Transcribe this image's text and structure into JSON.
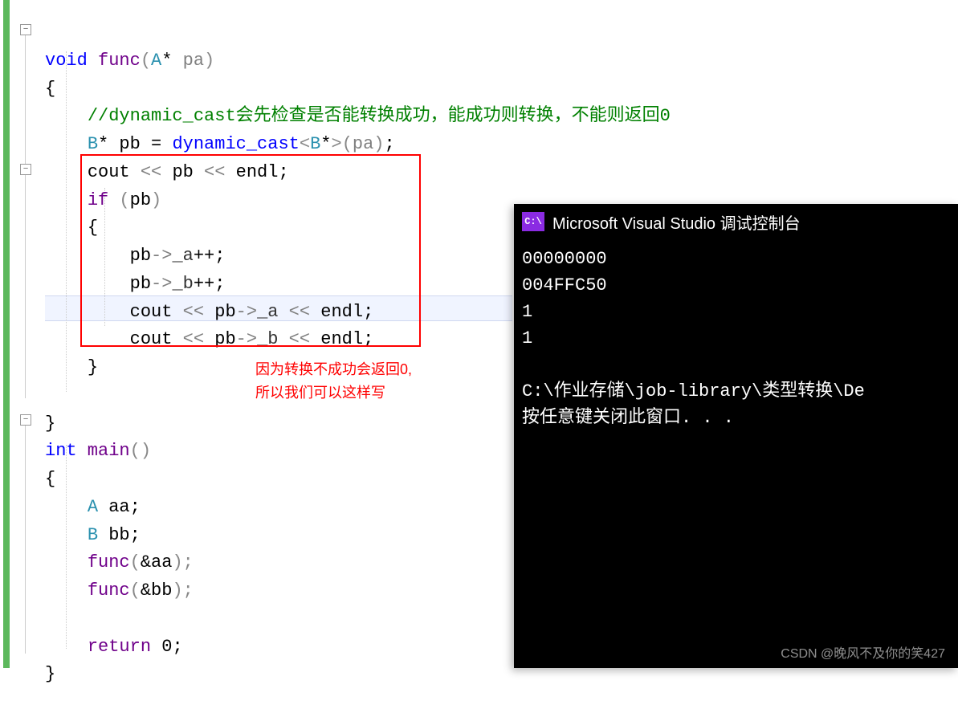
{
  "editor": {
    "fold_glyph": "−",
    "code": {
      "l1_kw_void": "void",
      "l1_func": " func",
      "l1_par_open": "(",
      "l1_type": "A",
      "l1_star": "* ",
      "l1_param": "pa",
      "l1_par_close": ")",
      "l2_brace": "{",
      "l3_comment": "//dynamic_cast会先检查是否能转换成功，能成功则转换，不能则返回0",
      "l4_type_B": "B",
      "l4_star_pb": "* pb = ",
      "l4_kw_dyn": "dynamic_cast",
      "l4_angle_open": "<",
      "l4_t": "B",
      "l4_star2": "*",
      "l4_angle_close": ">",
      "l4_po": "(",
      "l4_pa": "pa",
      "l4_pc": ")",
      "l4_semi": ";",
      "l5_cout": "cout ",
      "l5_lt1": "<< ",
      "l5_pb": "pb ",
      "l5_lt2": "<< ",
      "l5_endl": "endl",
      "l5_semi": ";",
      "l6_if": "if",
      "l6_po": " (",
      "l6_pb": "pb",
      "l6_pc": ")",
      "l7_brace": "{",
      "l8_pb": "pb",
      "l8_arrow": "->",
      "l8_a": "_a",
      "l8_inc": "++;",
      "l9_pb": "pb",
      "l9_arrow": "->",
      "l9_b": "_b",
      "l9_inc": "++;",
      "l10_cout": "cout ",
      "l10_lt1": "<< ",
      "l10_pb": "pb",
      "l10_arrow": "->",
      "l10_a": "_a ",
      "l10_lt2": "<< ",
      "l10_endl": "endl",
      "l10_semi": ";",
      "l11_cout": "cout ",
      "l11_lt1": "<< ",
      "l11_pb": "pb",
      "l11_arrow": "->",
      "l11_b": "_b ",
      "l11_lt2": "<< ",
      "l11_endl": "endl",
      "l11_semi": ";",
      "l12_brace": "}",
      "l14_brace": "}",
      "l15_int": "int",
      "l15_main": " main",
      "l15_parens": "()",
      "l16_brace": "{",
      "l17_A": "A",
      "l17_aa": " aa;",
      "l18_B": "B",
      "l18_bb": " bb;",
      "l19_func": "func",
      "l19_po": "(",
      "l19_amp": "&aa",
      "l19_pc": ");",
      "l20_func": "func",
      "l20_po": "(",
      "l20_amp": "&bb",
      "l20_pc": ");",
      "l22_ret": "return",
      "l22_zero": " 0",
      "l22_semi": ";",
      "l23_brace": "}"
    },
    "red_note_line1": "因为转换不成功会返回0,",
    "red_note_line2": "所以我们可以这样写"
  },
  "console": {
    "icon_text": "C:\\",
    "title": "Microsoft Visual Studio 调试控制台",
    "lines": {
      "l1": "00000000",
      "l2": "004FFC50",
      "l3": "1",
      "l4": "1",
      "l5": "",
      "l6": "C:\\作业存储\\job-library\\类型转换\\De",
      "l7": "按任意键关闭此窗口. . ."
    }
  },
  "watermark": "CSDN @晚风不及你的笑427"
}
